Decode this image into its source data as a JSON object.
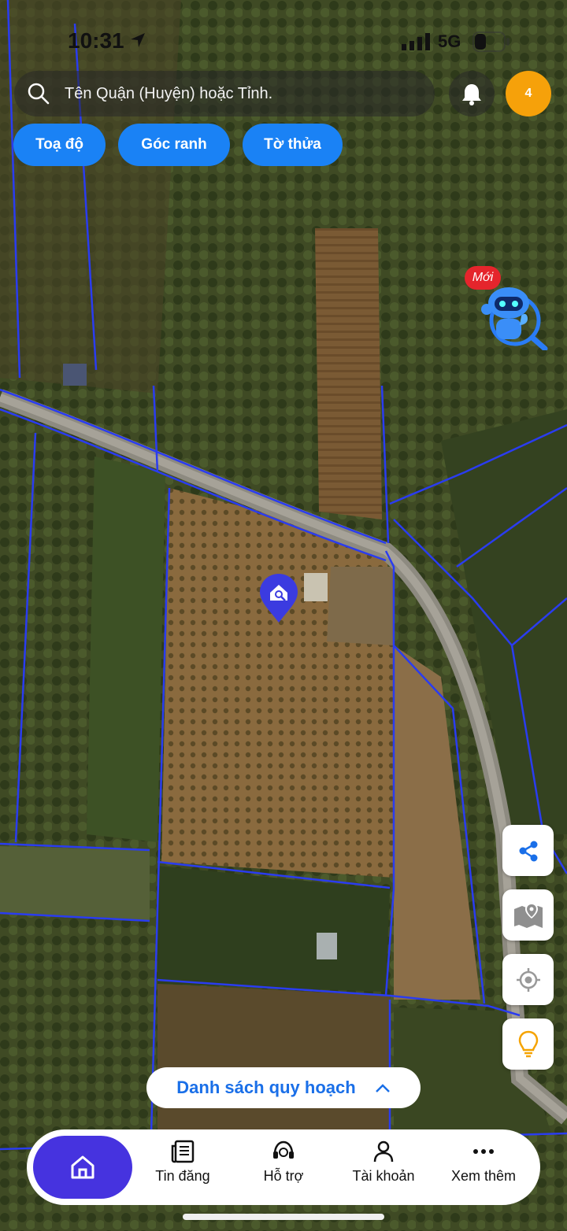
{
  "status_bar": {
    "time": "10:31",
    "network": "5G"
  },
  "search": {
    "placeholder": "Tên Quận (Huyện) hoặc Tỉnh."
  },
  "notifications": {
    "count": "4"
  },
  "chips": [
    {
      "label": "Toạ độ"
    },
    {
      "label": "Góc ranh"
    },
    {
      "label": "Tờ thửa"
    }
  ],
  "assistant": {
    "badge": "Mới"
  },
  "plan_list": {
    "label": "Danh sách quy hoạch"
  },
  "bottom_nav": {
    "items": [
      {
        "label": "Tin đăng",
        "icon": "news-icon"
      },
      {
        "label": "Hỗ trợ",
        "icon": "support-icon"
      },
      {
        "label": "Tài khoản",
        "icon": "account-icon"
      },
      {
        "label": "Xem thêm",
        "icon": "more-icon"
      }
    ]
  },
  "colors": {
    "chip": "#1a82f5",
    "badge": "#f6a10a",
    "home_active": "#4633df",
    "parcel_line": "#2a3cf0",
    "pin": "#3b3be0",
    "new_badge": "#e5252c"
  }
}
